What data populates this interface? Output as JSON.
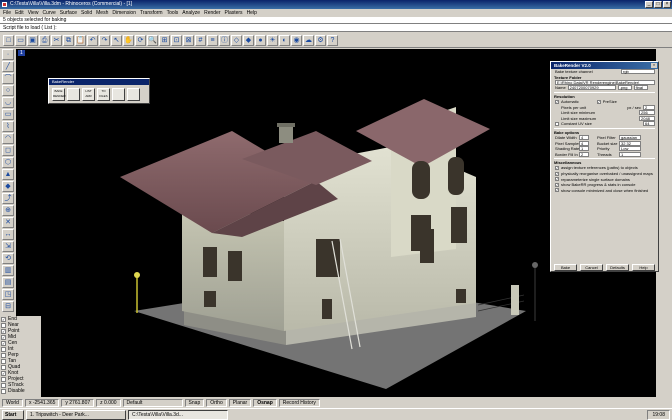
{
  "window": {
    "title": "C:\\Testa\\Villa\\Villa.3dm - Rhinoceros (Commercial) - [1]"
  },
  "menu": [
    "File",
    "Edit",
    "View",
    "Curve",
    "Surface",
    "Solid",
    "Mesh",
    "Dimension",
    "Transform",
    "Tools",
    "Analyze",
    "Render",
    "Plasters",
    "Help"
  ],
  "command": {
    "history": "5 objects selected for baking",
    "prompt": "Script file to load ( List ):"
  },
  "viewport": {
    "label": "1"
  },
  "toolbar_icons": [
    "new-icon",
    "open-icon",
    "save-icon",
    "print-icon",
    "cut-icon",
    "copy-icon",
    "paste-icon",
    "undo-icon",
    "redo-icon",
    "select-icon",
    "pan-icon",
    "rotate-icon",
    "zoom-icon",
    "zoom-window-icon",
    "zoom-extents-icon",
    "zoom-selected-icon",
    "grid-icon",
    "layers-icon",
    "properties-icon",
    "wireframe-icon",
    "shaded-icon",
    "rendered-icon",
    "light-icon",
    "material-icon",
    "render-icon",
    "environment-icon",
    "options-icon",
    "help-icon"
  ],
  "left_tools_count": 22,
  "osnap": [
    "End",
    "Near",
    "Point",
    "Mid",
    "Cen",
    "Int",
    "Perp",
    "Tan",
    "Quad",
    "Knot",
    "Project",
    "STrack",
    "Disable"
  ],
  "osnap_checked": [
    "End",
    "Point",
    "Mid",
    "Cen",
    "Knot"
  ],
  "bake_mini": {
    "title": "BakeRender",
    "buttons": [
      "BAKE RENDER",
      "",
      "LIST ARR",
      "TO FILES",
      "",
      ""
    ]
  },
  "dialog": {
    "title": "BakeRender V2.0",
    "channel_label": "Bake texture channel",
    "channel_value": "rgb",
    "texture_folder_label": "Texture Folder",
    "folder_path": "E:\\Rhino Data\\VR Renderengine\\BakeRender\\",
    "name_label": "Name",
    "name_value": "2407200070929",
    "ext_value": ".png",
    "mode_value": "final",
    "resolution_label": "Resolution",
    "automatic": "Automatic",
    "presize": "PreSize",
    "pixels_per_unit": "Pixels per unit",
    "px_sec": "px / sec",
    "px_sec_value": "2",
    "limit_min": "Limit size minimum",
    "limit_min_value": "256",
    "limit_max": "Limit size maximum",
    "limit_max_value": "2048",
    "constant_uv": "Constant UV size",
    "px_value": "64",
    "bake_options": "Bake options",
    "dilate_width": "Dilate Width",
    "dilate_width_value": "4",
    "pixel_filter": "Pixel Filter",
    "pixel_filter_value": "gaussian",
    "pixel_samples": "Pixel Samples",
    "pixel_samples_value": "4",
    "bucket_size": "Bucket size",
    "bucket_size_value": "32 32",
    "shading_rate": "Shading Rate",
    "shading_rate_value": "1",
    "priority": "Priority",
    "priority_value": "Low",
    "border_fill": "Border Fill In",
    "border_fill_value": "2",
    "threads": "Threads",
    "threads_value": "1",
    "misc": "Miscellaneous",
    "options": [
      "assign texture references (paths) to objects",
      "physically reorganise overbaked / unassigned maps",
      "reparameterize single surface domains",
      "show BakeRR progress & stats in console",
      "show console minimized and close when finished"
    ],
    "buttons": [
      "Bake",
      "Cancel",
      "Defaults",
      "Help"
    ]
  },
  "status": {
    "world": "World",
    "x": "x -2541.365",
    "y": "y 2761.807",
    "z": "z 0.000",
    "layer": "Default",
    "toggles": [
      "Snap",
      "Ortho",
      "Planar",
      "Osnap",
      "Record History"
    ]
  },
  "taskbar": {
    "start": "Start",
    "tasks": [
      "1. Tripswitch - Deer Park...",
      "C:\\Testa\\Villa\\Villa.3d..."
    ],
    "clock": "19:08"
  }
}
